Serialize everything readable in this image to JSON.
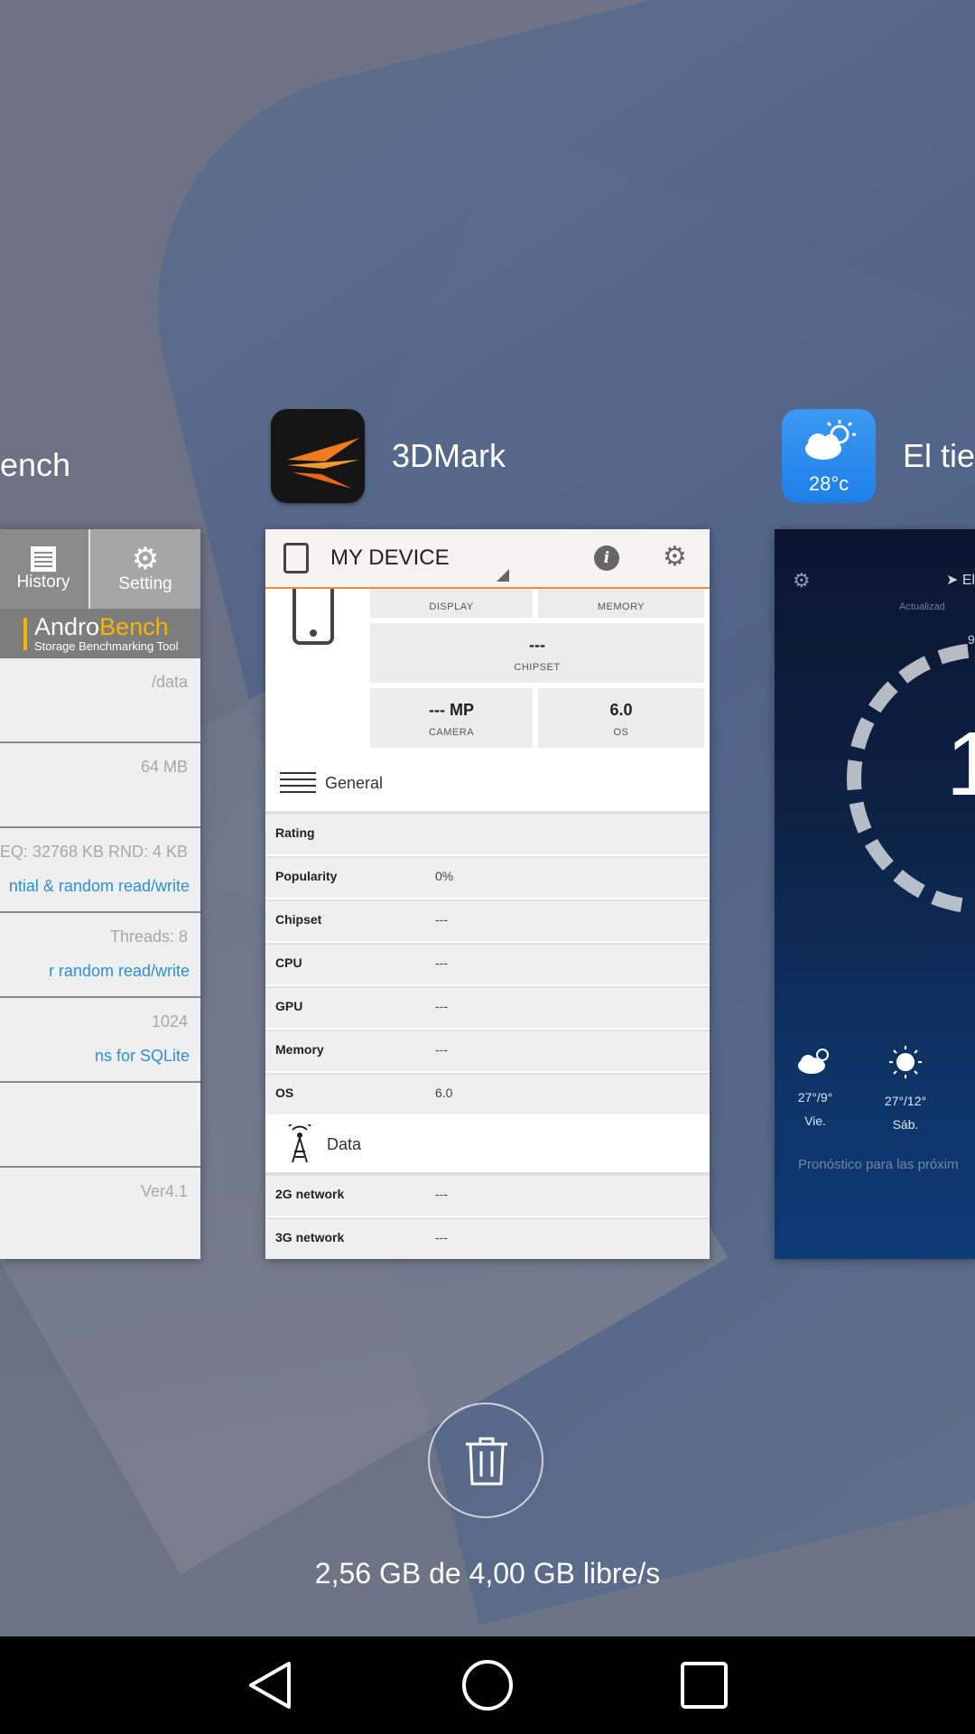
{
  "apps": {
    "left": {
      "name": "ench",
      "tabs": [
        "History",
        "Setting"
      ],
      "logo_line1_a": "Andro",
      "logo_line1_b": "Bench",
      "logo_line2": "Storage Benchmarking Tool",
      "rows": [
        {
          "value": "/data",
          "desc": ""
        },
        {
          "value": "64 MB",
          "desc": ""
        },
        {
          "value": "EQ: 32768 KB  RND: 4 KB",
          "desc": "ntial & random read/write"
        },
        {
          "value": "Threads: 8",
          "desc": "r random read/write"
        },
        {
          "value": "1024",
          "desc": "ns for SQLite"
        },
        {
          "value": "",
          "desc": ""
        },
        {
          "value": "Ver4.1",
          "desc": ""
        }
      ]
    },
    "center": {
      "name": "3DMark",
      "header_title": "MY DEVICE",
      "specs": {
        "display_label": "DISPLAY",
        "memory_label": "MEMORY",
        "chipset_value": "---",
        "chipset_label": "CHIPSET",
        "camera_value": "--- MP",
        "camera_label": "CAMERA",
        "os_value": "6.0",
        "os_label": "OS"
      },
      "general_label": "General",
      "general_rows": [
        {
          "key": "Rating",
          "value": ""
        },
        {
          "key": "Popularity",
          "value": "0%"
        },
        {
          "key": "Chipset",
          "value": "---"
        },
        {
          "key": "CPU",
          "value": "---"
        },
        {
          "key": "GPU",
          "value": "---"
        },
        {
          "key": "Memory",
          "value": "---"
        },
        {
          "key": "OS",
          "value": "6.0"
        }
      ],
      "data_label": "Data",
      "data_rows": [
        {
          "key": "2G network",
          "value": "---"
        },
        {
          "key": "3G network",
          "value": "---"
        }
      ]
    },
    "right": {
      "name": "El tie",
      "icon_temp": "28°c",
      "location": "El",
      "updated": "Actualizad",
      "dial_top": "9",
      "big_number": "1",
      "forecast": [
        {
          "icon": "cloud-sun-icon",
          "temp": "27°/9°",
          "day": "Vie."
        },
        {
          "icon": "sun-icon",
          "temp": "27°/12°",
          "day": "Sáb."
        }
      ],
      "footer": "Pronóstico para las próxim"
    }
  },
  "memory_text": "2,56 GB de 4,00 GB libre/s",
  "nav": {
    "back": "back-icon",
    "home": "home-icon",
    "recents": "recents-icon"
  }
}
